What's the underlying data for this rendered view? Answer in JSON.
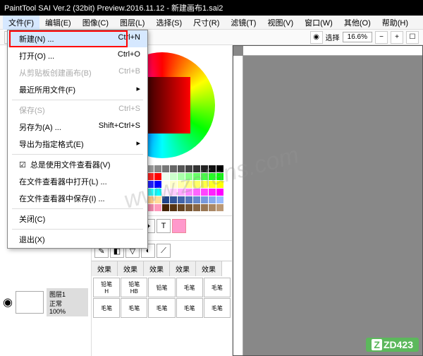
{
  "title": "PaintTool SAI Ver.2 (32bit) Preview.2016.11.12 - 新建画布1.sai2",
  "menu": {
    "items": [
      "文件(F)",
      "编辑(E)",
      "图像(C)",
      "图层(L)",
      "选择(S)",
      "尺寸(R)",
      "滤镜(T)",
      "视图(V)",
      "窗口(W)",
      "其他(O)",
      "帮助(H)"
    ],
    "active_index": 0
  },
  "file_menu": [
    {
      "label": "新建(N) ...",
      "shortcut": "Ctrl+N",
      "enabled": true,
      "highlight": true
    },
    {
      "label": "打开(O) ...",
      "shortcut": "Ctrl+O",
      "enabled": true
    },
    {
      "label": "从剪贴板创建画布(B)",
      "shortcut": "Ctrl+B",
      "enabled": false
    },
    {
      "label": "最近所用文件(F)",
      "shortcut": "",
      "enabled": true,
      "submenu": true
    },
    {
      "sep": true
    },
    {
      "label": "保存(S)",
      "shortcut": "Ctrl+S",
      "enabled": false
    },
    {
      "label": "另存为(A) ...",
      "shortcut": "Shift+Ctrl+S",
      "enabled": true
    },
    {
      "label": "导出为指定格式(E)",
      "shortcut": "",
      "enabled": true,
      "submenu": true
    },
    {
      "sep": true
    },
    {
      "label": "总是使用文件查看器(V)",
      "shortcut": "",
      "enabled": true,
      "checkbox": true,
      "checked": true
    },
    {
      "label": "在文件查看器中打开(L) ...",
      "shortcut": "",
      "enabled": true
    },
    {
      "label": "在文件查看器中保存(I) ...",
      "shortcut": "",
      "enabled": true
    },
    {
      "sep": true
    },
    {
      "label": "关闭(C)",
      "shortcut": "",
      "enabled": true
    },
    {
      "sep": true
    },
    {
      "label": "退出(X)",
      "shortcut": "",
      "enabled": true
    }
  ],
  "toolbar": {
    "select_label": "选择",
    "zoom": "16.6%"
  },
  "layer": {
    "name": "图层1",
    "mode": "正常",
    "opacity": "100%"
  },
  "brushes": {
    "tabs": [
      "效果",
      "效果",
      "效果",
      "效果",
      "效果"
    ],
    "cells": [
      {
        "n": "铅笔",
        "s": "H"
      },
      {
        "n": "铅笔",
        "s": "HB"
      },
      {
        "n": "铅笔",
        "s": ""
      },
      {
        "n": "毛笔",
        "s": ""
      },
      {
        "n": "毛笔",
        "s": ""
      },
      {
        "n": "毛笔",
        "s": ""
      },
      {
        "n": "毛笔",
        "s": ""
      },
      {
        "n": "毛笔",
        "s": ""
      },
      {
        "n": "毛笔",
        "s": ""
      },
      {
        "n": "毛笔",
        "s": ""
      }
    ]
  },
  "swatch_colors": [
    "#fff",
    "#eee",
    "#ddd",
    "#ccc",
    "#bbb",
    "#aaa",
    "#999",
    "#888",
    "#777",
    "#666",
    "#555",
    "#444",
    "#333",
    "#222",
    "#111",
    "#000",
    "#fee",
    "#fcc",
    "#faa",
    "#f88",
    "#f66",
    "#f44",
    "#f22",
    "#f00",
    "#efe",
    "#cfc",
    "#afa",
    "#8f8",
    "#6f6",
    "#4f4",
    "#2f2",
    "#0f0",
    "#eef",
    "#ccf",
    "#aaf",
    "#88f",
    "#66f",
    "#44f",
    "#22f",
    "#00f",
    "#ffe",
    "#ffc",
    "#ffa",
    "#ff8",
    "#ff6",
    "#ff4",
    "#ff2",
    "#ff0",
    "#eff",
    "#cff",
    "#aff",
    "#8ff",
    "#6ff",
    "#4ff",
    "#2ff",
    "#0ff",
    "#fef",
    "#fcf",
    "#faf",
    "#f8f",
    "#f6f",
    "#f4f",
    "#f2f",
    "#f0f",
    "#862",
    "#a73",
    "#c84",
    "#e95",
    "#fa6",
    "#fb7",
    "#fc8",
    "#fd9",
    "#248",
    "#359",
    "#46a",
    "#57b",
    "#68c",
    "#79d",
    "#8ae",
    "#9bf",
    "#824",
    "#935",
    "#a46",
    "#b57",
    "#c68",
    "#d79",
    "#e8a",
    "#f9b",
    "#420",
    "#531",
    "#642",
    "#753",
    "#864",
    "#975",
    "#a86",
    "#b97"
  ],
  "watermark": "www.zdfans.com",
  "badge": "ZD423"
}
